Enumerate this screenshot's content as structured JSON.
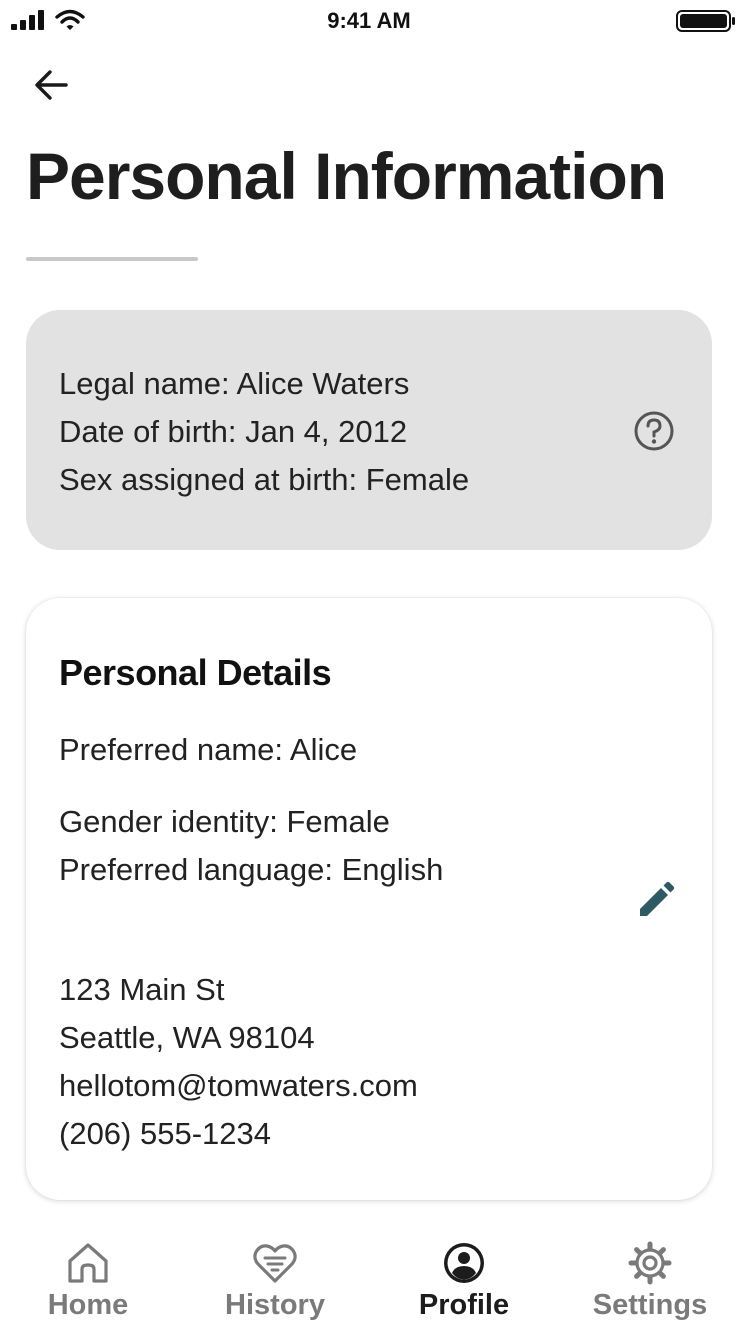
{
  "status_bar": {
    "time": "9:41 AM",
    "icons": [
      "signal-icon",
      "wifi-icon",
      "battery-icon"
    ]
  },
  "header": {
    "back_icon": "arrow-left-icon",
    "title": "Personal Information"
  },
  "legal_info": {
    "lines": [
      "Legal name: Alice Waters",
      "Date of birth: Jan 4, 2012",
      "Sex assigned at birth: Female"
    ],
    "help_icon": "question-circle-icon"
  },
  "personal_details": {
    "title": "Personal Details",
    "preferred_name": "Preferred name: Alice",
    "gender_identity": "Gender identity: Female",
    "preferred_language": "Preferred language: English",
    "address_line1": "123 Main St",
    "address_line2": "Seattle, WA 98104",
    "email": "hellotom@tomwaters.com",
    "phone": "(206) 555-1234",
    "edit_icon": "pencil-icon"
  },
  "bottom_nav": {
    "items": [
      {
        "label": "Home",
        "icon": "home-icon",
        "active": false
      },
      {
        "label": "History",
        "icon": "heart-list-icon",
        "active": false
      },
      {
        "label": "Profile",
        "icon": "user-circle-icon",
        "active": true
      },
      {
        "label": "Settings",
        "icon": "gear-icon",
        "active": false
      }
    ]
  },
  "colors": {
    "info_card_bg": "#e2e2e2",
    "edit_icon": "#2d5a63",
    "nav_inactive": "#7a7a7a",
    "nav_active": "#1c1c1c"
  }
}
